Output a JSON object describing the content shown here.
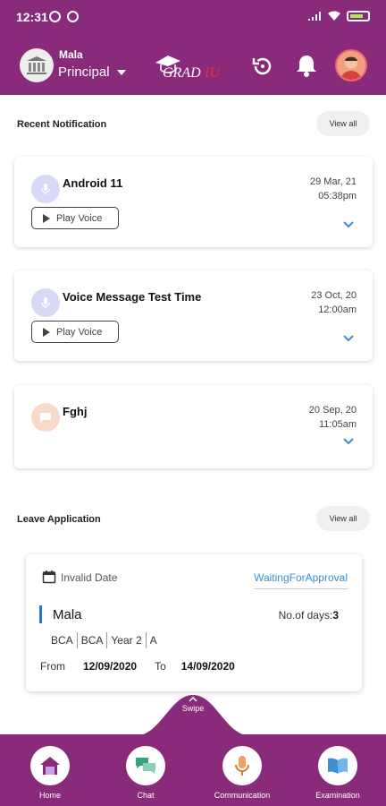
{
  "status_bar": {
    "time": "12:31"
  },
  "header": {
    "user_name": "Mala",
    "role": "Principal",
    "logo_text": "GRAD",
    "logo_accent": "IU",
    "brand_color": "#8a2a7a"
  },
  "recent_notifications": {
    "title": "Recent Notification",
    "view_all": "View all",
    "items": [
      {
        "title": "Android 11",
        "date": "29 Mar, 21",
        "time": "05:38pm",
        "type": "voice",
        "button": "Play Voice"
      },
      {
        "title": "Voice Message Test Time",
        "date": "23 Oct, 20",
        "time": "12:00am",
        "type": "voice",
        "button": "Play Voice"
      },
      {
        "title": "Fghj",
        "date": "20 Sep, 20",
        "time": "11:05am",
        "type": "message"
      }
    ]
  },
  "leave_application": {
    "title": "Leave Application",
    "view_all": "View all",
    "card": {
      "date_text": "Invalid Date",
      "status": "WaitingForApproval",
      "name": "Mala",
      "days_label": "No.of days:",
      "days_value": "3",
      "tags": [
        "BCA",
        "BCA",
        "Year 2",
        "A"
      ],
      "from_label": "From",
      "from_date": "12/09/2020",
      "to_label": "To",
      "to_date": "14/09/2020"
    }
  },
  "swipe_label": "Swipe",
  "bottom_nav": [
    {
      "label": "Home",
      "icon": "home-icon"
    },
    {
      "label": "Chat",
      "icon": "chat-icon"
    },
    {
      "label": "Communication",
      "icon": "mic-icon"
    },
    {
      "label": "Examination",
      "icon": "book-icon"
    }
  ]
}
